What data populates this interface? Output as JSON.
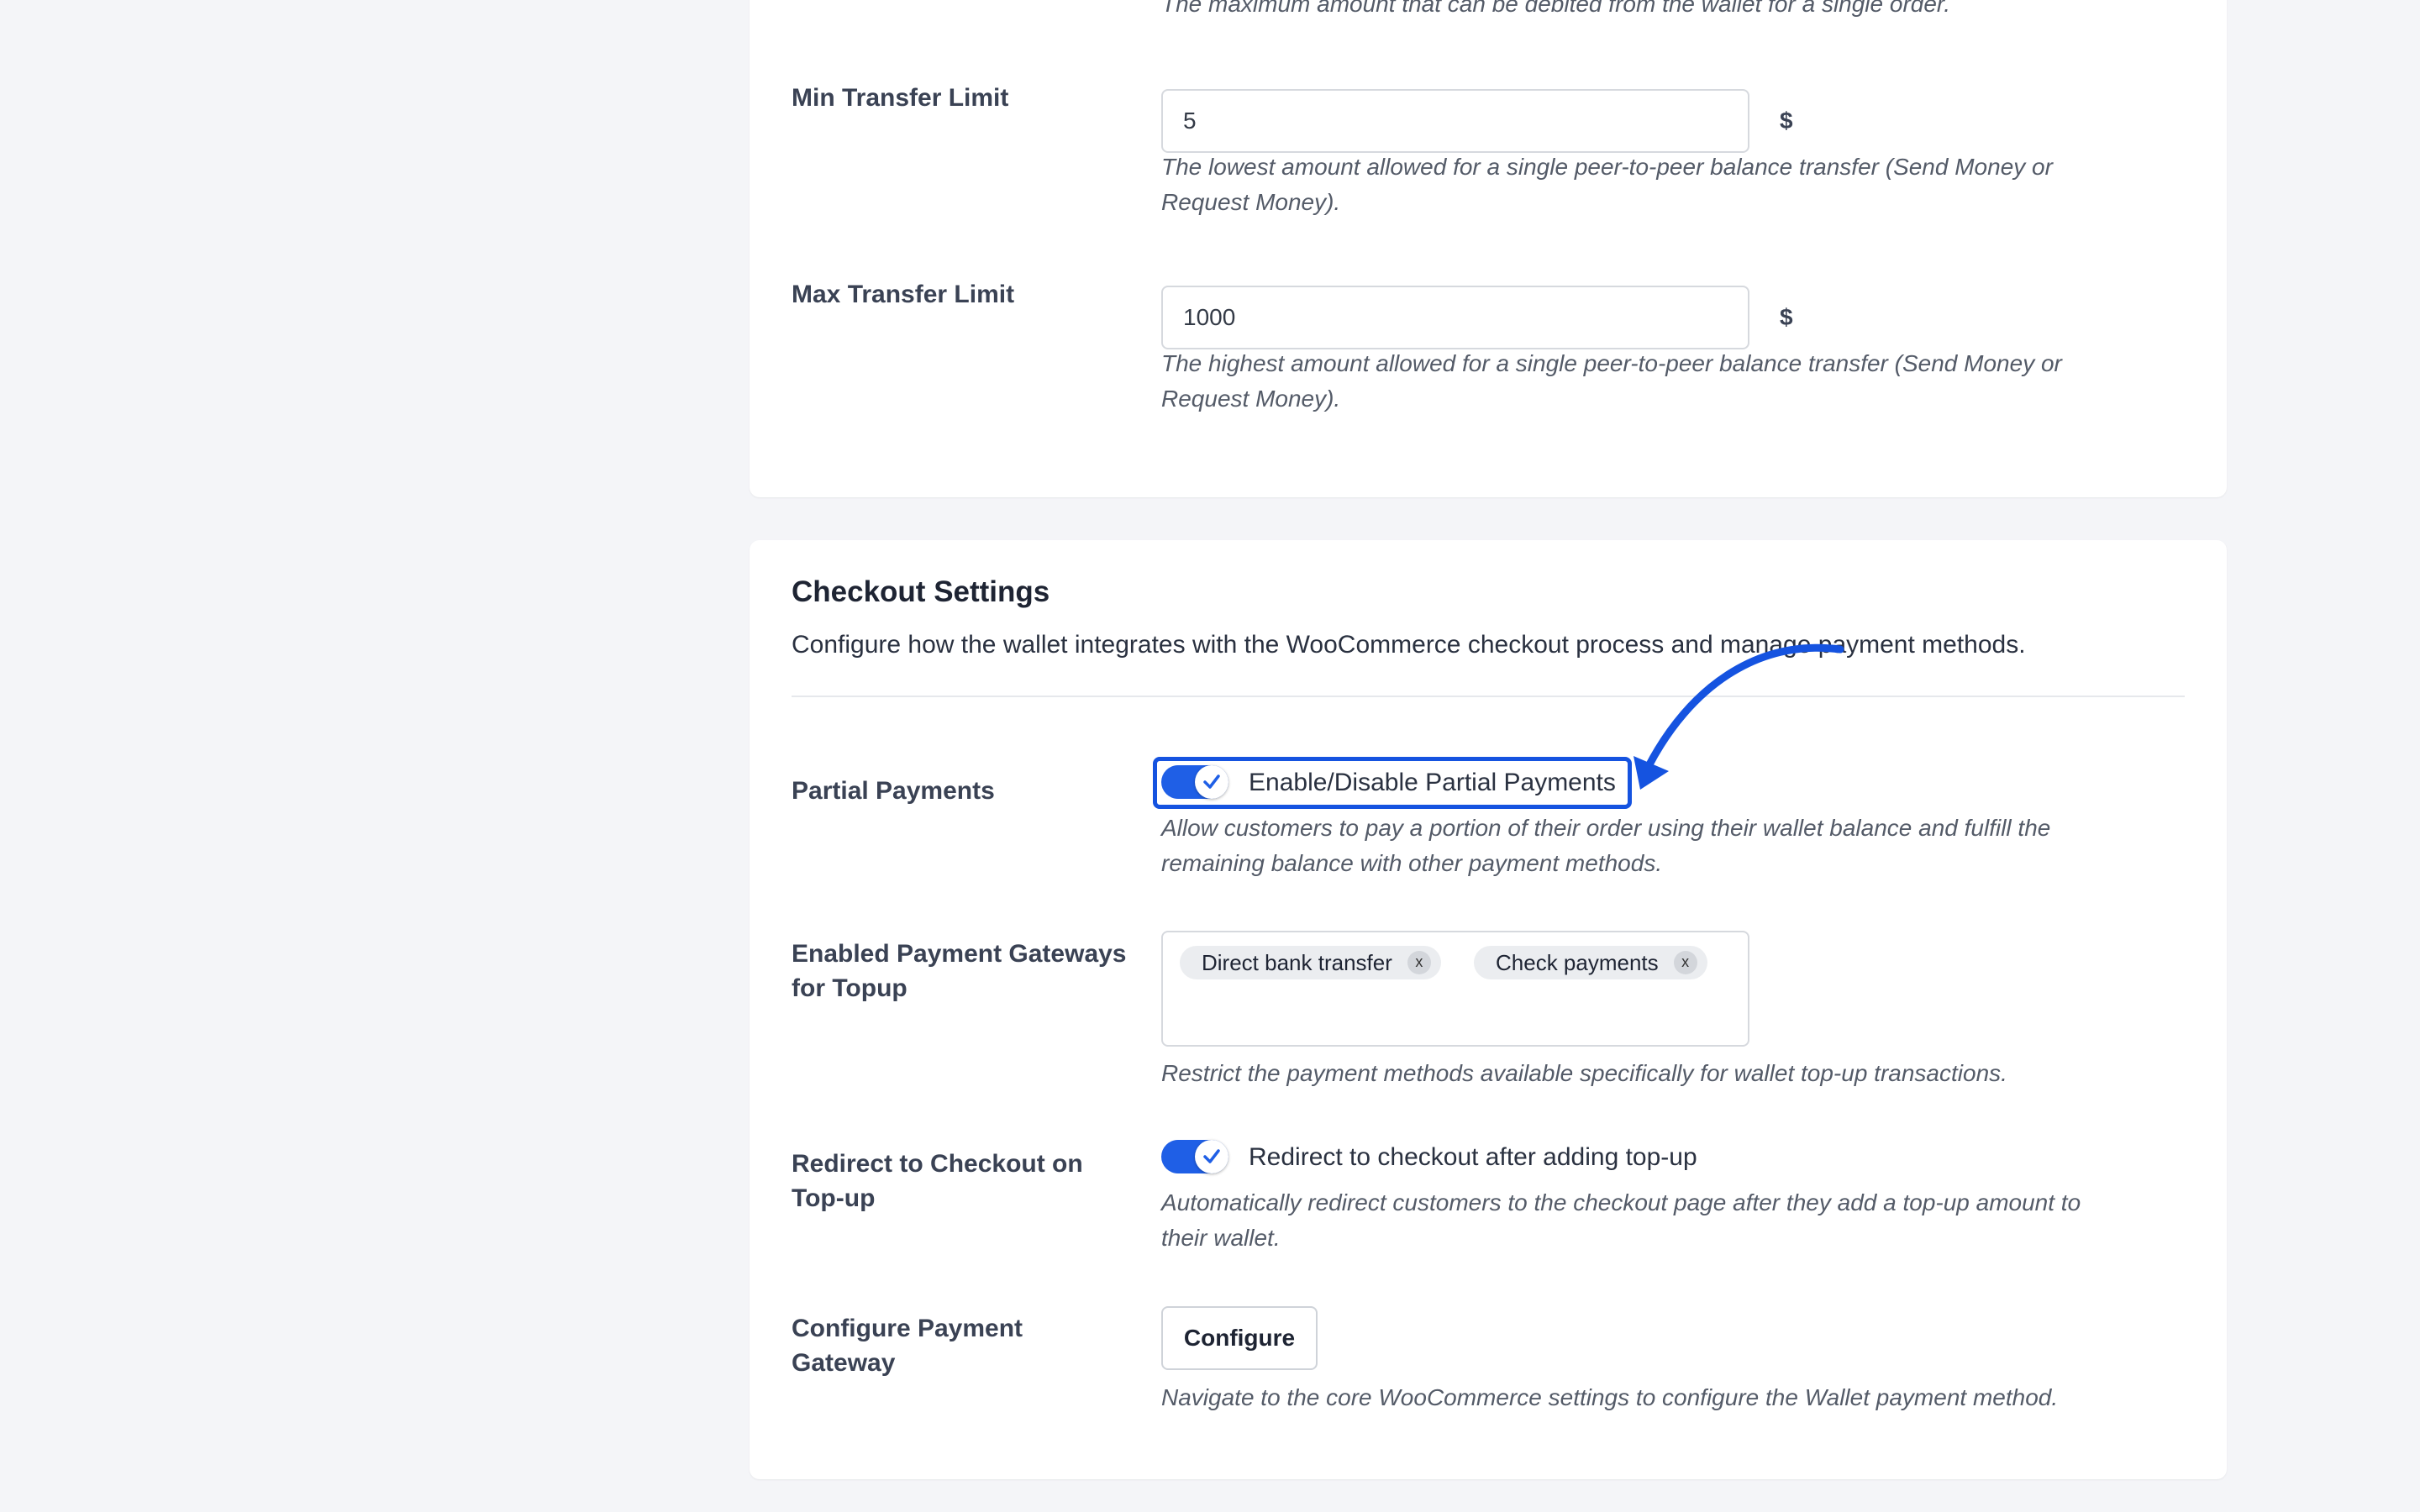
{
  "colors": {
    "page_bg": "#f4f5f8",
    "card_bg": "#ffffff",
    "accent_blue": "#1f5fe6",
    "annotation_blue": "#1553e0"
  },
  "limits_card": {
    "max_debit_desc": "The maximum amount that can be debited from the wallet for a single order.",
    "min_transfer": {
      "label": "Min Transfer Limit",
      "value": "5",
      "currency": "$",
      "desc_line1": "The lowest amount allowed for a single peer-to-peer balance transfer (Send Money or",
      "desc_line2": "Request Money)."
    },
    "max_transfer": {
      "label": "Max Transfer Limit",
      "value": "1000",
      "currency": "$",
      "desc_line1": "The highest amount allowed for a single peer-to-peer balance transfer (Send Money or",
      "desc_line2": "Request Money)."
    }
  },
  "checkout": {
    "title": "Checkout Settings",
    "description": "Configure how the wallet integrates with the WooCommerce checkout process and manage payment methods.",
    "partial_payments": {
      "label": "Partial Payments",
      "toggle_text": "Enable/Disable Partial Payments",
      "enabled": true,
      "desc_line1": "Allow customers to pay a portion of their order using their wallet balance and fulfill the",
      "desc_line2": "remaining balance with other payment methods."
    },
    "gateways": {
      "label_line1": "Enabled Payment Gateways",
      "label_line2": "for Topup",
      "chips": [
        {
          "label": "Direct bank transfer",
          "remove": "x"
        },
        {
          "label": "Check payments",
          "remove": "x"
        }
      ],
      "desc": "Restrict the payment methods available specifically for wallet top-up transactions."
    },
    "redirect": {
      "label_line1": "Redirect to Checkout on",
      "label_line2": "Top-up",
      "toggle_text": "Redirect to checkout after adding top-up",
      "enabled": true,
      "desc_line1": "Automatically redirect customers to the checkout page after they add a top-up amount to",
      "desc_line2": "their wallet."
    },
    "configure": {
      "label_line1": "Configure Payment",
      "label_line2": "Gateway",
      "button_label": "Configure",
      "desc": "Navigate to the core WooCommerce settings to configure the Wallet payment method."
    }
  },
  "icons": {
    "check": "check-icon",
    "annotation": "annotation-arrow-icon"
  }
}
